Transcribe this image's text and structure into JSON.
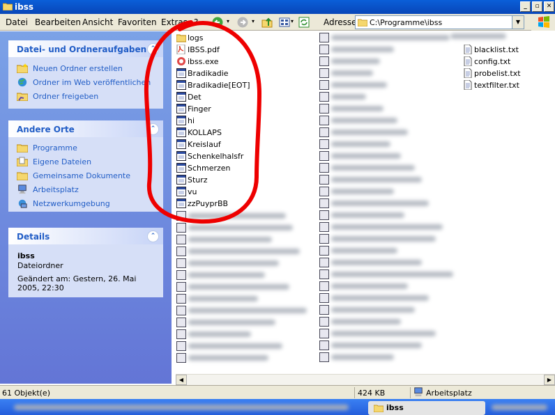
{
  "window": {
    "title": "ibss"
  },
  "menu": [
    "Datei",
    "Bearbeiten",
    "Ansicht",
    "Favoriten",
    "Extras",
    "?"
  ],
  "address": {
    "label": "Adresse",
    "value": "C:\\Programme\\ibss"
  },
  "tasks": {
    "title": "Datei- und Ordneraufgaben",
    "items": [
      "Neuen Ordner erstellen",
      "Ordner im Web veröffentlichen",
      "Ordner freigeben"
    ]
  },
  "other_places": {
    "title": "Andere Orte",
    "items": [
      "Programme",
      "Eigene Dateien",
      "Gemeinsame Dokumente",
      "Arbeitsplatz",
      "Netzwerkumgebung"
    ]
  },
  "details": {
    "title": "Details",
    "name": "ibss",
    "type": "Dateiordner",
    "modified": "Geändert am: Gestern, 26. Mai 2005, 22:30"
  },
  "files_col1": [
    {
      "name": "logs",
      "icon": "folder-icon"
    },
    {
      "name": "IBSS.pdf",
      "icon": "pdf-icon"
    },
    {
      "name": "ibss.exe",
      "icon": "exe-icon"
    },
    {
      "name": "Bradikadie",
      "icon": "window-icon"
    },
    {
      "name": "Bradikadie[EOT]",
      "icon": "window-icon"
    },
    {
      "name": "Det",
      "icon": "window-icon"
    },
    {
      "name": "Finger",
      "icon": "window-icon"
    },
    {
      "name": "hi",
      "icon": "window-icon"
    },
    {
      "name": "KOLLAPS",
      "icon": "window-icon"
    },
    {
      "name": "Kreislauf",
      "icon": "window-icon"
    },
    {
      "name": "Schenkelhalsfr",
      "icon": "window-icon"
    },
    {
      "name": "Schmerzen",
      "icon": "window-icon"
    },
    {
      "name": "Sturz",
      "icon": "window-icon"
    },
    {
      "name": "vu",
      "icon": "window-icon"
    },
    {
      "name": "zzPuyprBB",
      "icon": "window-icon"
    }
  ],
  "files_col3": [
    {
      "name": "blacklist.txt",
      "icon": "text-file-icon"
    },
    {
      "name": "config.txt",
      "icon": "text-file-icon"
    },
    {
      "name": "probelist.txt",
      "icon": "text-file-icon"
    },
    {
      "name": "textfilter.txt",
      "icon": "text-file-icon"
    }
  ],
  "status": {
    "count": "61 Objekt(e)",
    "size": "424 KB",
    "location": "Arbeitsplatz"
  },
  "taskbar": {
    "window": "ibss"
  },
  "colors": {
    "xp_blue": "#0846b8",
    "panel_text": "#215dc6",
    "annotation": "#ee0000"
  }
}
